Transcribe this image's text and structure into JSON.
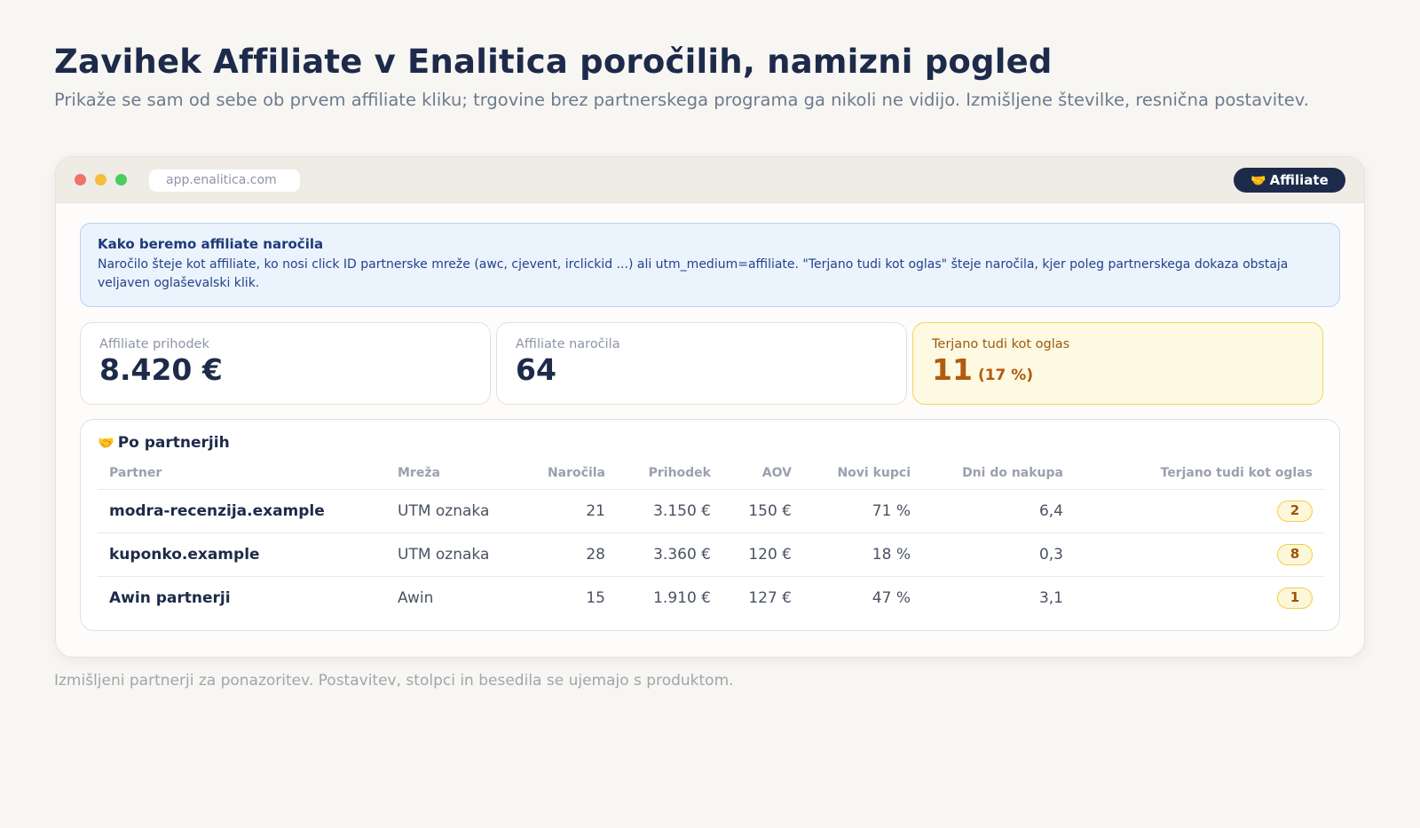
{
  "header": {
    "title": "Zavihek Affiliate v Enalitica poročilih, namizni pogled",
    "subtitle": "Prikaže se sam od sebe ob prvem affiliate kliku; trgovine brez partnerskega programa ga nikoli ne vidijo. Izmišljene številke, resnična postavitev."
  },
  "window": {
    "url": "app.enalitica.com",
    "tab_label": "Affiliate",
    "tab_emoji": "🤝"
  },
  "info": {
    "title": "Kako beremo affiliate naročila",
    "text": "Naročilo šteje kot affiliate, ko nosi click ID partnerske mreže (awc, cjevent, irclickid ...) ali utm_medium=affiliate. \"Terjano tudi kot oglas\" šteje naročila, kjer poleg partnerskega dokaza obstaja veljaven oglaševalski klik."
  },
  "kpis": [
    {
      "label": "Affiliate prihodek",
      "value": "8.420 €"
    },
    {
      "label": "Affiliate naročila",
      "value": "64"
    },
    {
      "label": "Terjano tudi kot oglas",
      "value": "11",
      "extra": "(17 %)"
    }
  ],
  "table": {
    "title": "Po partnerjih",
    "title_emoji": "🤝",
    "columns": [
      "Partner",
      "Mreža",
      "Naročila",
      "Prihodek",
      "AOV",
      "Novi kupci",
      "Dni do nakupa",
      "Terjano tudi kot oglas"
    ],
    "rows": [
      {
        "partner": "modra-recenzija.example",
        "network": "UTM oznaka",
        "orders": "21",
        "revenue": "3.150 €",
        "aov": "150 €",
        "new_customers": "71 %",
        "days": "6,4",
        "claimed": "2"
      },
      {
        "partner": "kuponko.example",
        "network": "UTM oznaka",
        "orders": "28",
        "revenue": "3.360 €",
        "aov": "120 €",
        "new_customers": "18 %",
        "days": "0,3",
        "claimed": "8"
      },
      {
        "partner": "Awin partnerji",
        "network": "Awin",
        "orders": "15",
        "revenue": "1.910 €",
        "aov": "127 €",
        "new_customers": "47 %",
        "days": "3,1",
        "claimed": "1"
      }
    ]
  },
  "footnote": "Izmišljeni partnerji za ponazoritev. Postavitev, stolpci in besedila se ujemajo s produktom.",
  "colors": {
    "navy": "#1e2a4a",
    "info_bg": "#ebf3fd",
    "warn_bg": "#fef9e2",
    "warn_accent": "#b25a0d"
  }
}
